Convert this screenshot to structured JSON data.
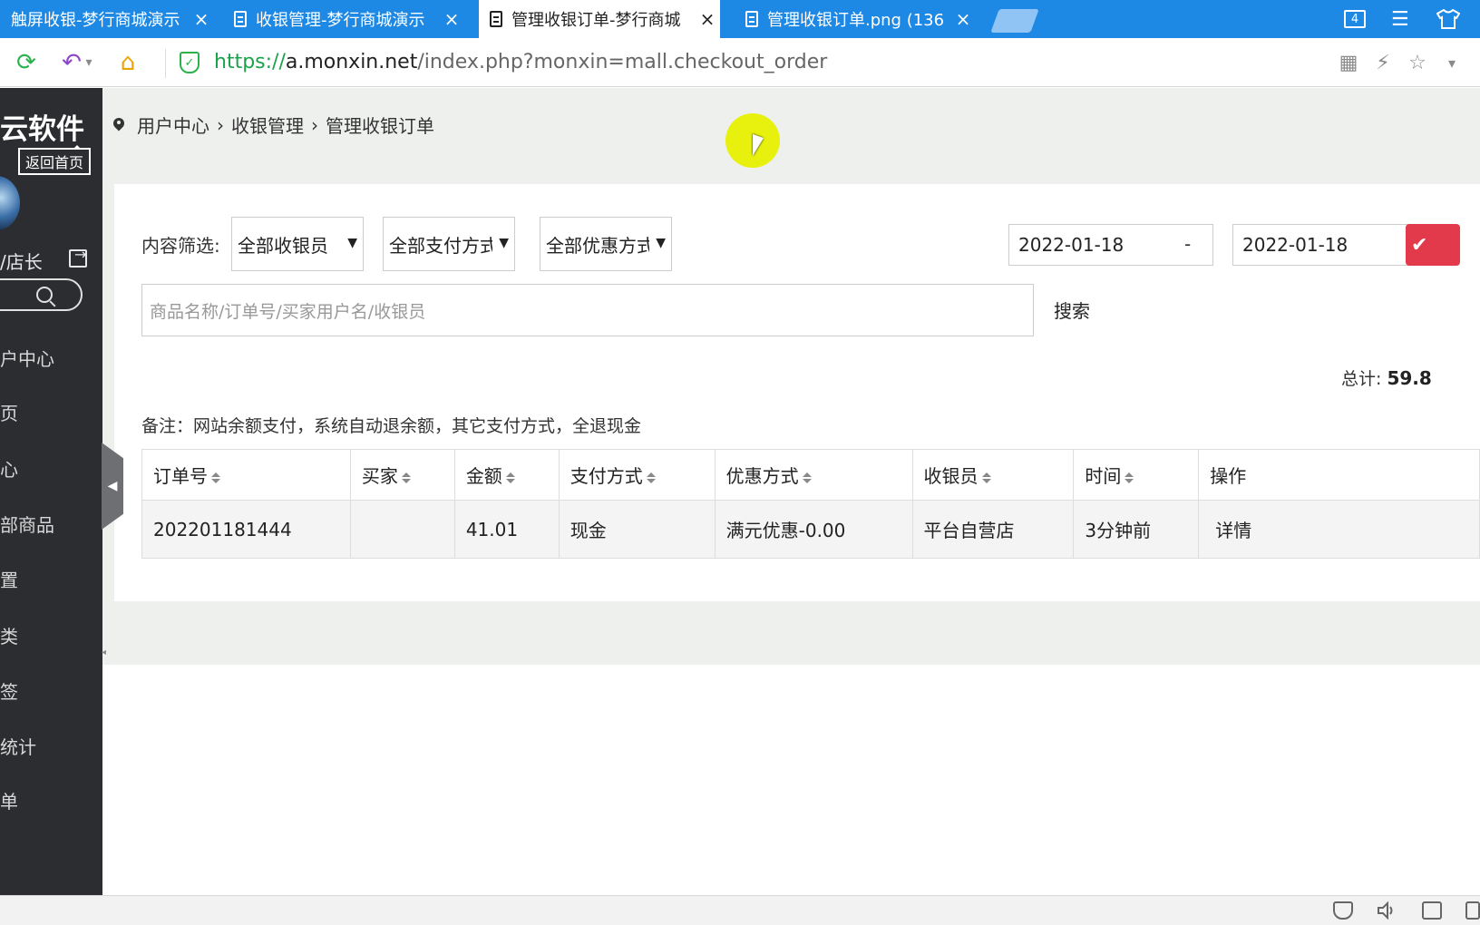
{
  "browser": {
    "tabs": [
      {
        "label": "触屏收银-梦行商城演示"
      },
      {
        "label": "收银管理-梦行商城演示"
      },
      {
        "label": "管理收银订单-梦行商城"
      },
      {
        "label": "管理收银订单.png (136"
      }
    ],
    "tab_close": "×",
    "window_count": "4",
    "url_scheme": "https://",
    "url_host": "a.monxin.net",
    "url_path": "/index.php?monxin=mall.checkout_order"
  },
  "sidebar": {
    "brand": "云软件",
    "back_home": "返回首页",
    "user": "/店长",
    "items": [
      "户中心",
      "页",
      "心",
      "部商品",
      "置",
      "类",
      "签",
      "统计",
      "单"
    ]
  },
  "breadcrumb": {
    "items": [
      "用户中心",
      "收银管理",
      "管理收银订单"
    ],
    "separator": "›"
  },
  "filters": {
    "label": "内容筛选:",
    "cashier": "全部收银员",
    "payment": "全部支付方式",
    "discount": "全部优惠方式",
    "caret": "▼",
    "date_from": "2022-01-18",
    "date_to": "2022-01-18",
    "date_sep": "-",
    "confirm_icon": "✔"
  },
  "search": {
    "placeholder": "商品名称/订单号/买家用户名/收银员",
    "button": "搜索"
  },
  "summary": {
    "total_label": "总计:",
    "total_value": "59.8"
  },
  "note": "备注：网站余额支付，系统自动退余额，其它支付方式，全退现金",
  "table": {
    "headers": [
      "订单号",
      "买家",
      "金额",
      "支付方式",
      "优惠方式",
      "收银员",
      "时间",
      "操作"
    ],
    "rows": [
      {
        "order_no": "202201181444",
        "buyer": "",
        "amount": "41.01",
        "payment": "现金",
        "discount": "满元优惠-0.00",
        "cashier": "平台自营店",
        "time": "3分钟前",
        "action": "详情"
      }
    ]
  },
  "colors": {
    "tabbar": "#1e88e5",
    "sidebar": "#2b2d30",
    "confirm": "#e23a4a",
    "url_green": "#1aa34a"
  },
  "icons": {
    "reload": "⟳",
    "undo": "↶",
    "home": "⌂",
    "menu": "☰",
    "shirt": "👕",
    "qr": "▦",
    "bolt": "⚡",
    "star": "☆",
    "dropdown": "▾",
    "collapse": "◀",
    "mini_arrow": "◂"
  }
}
